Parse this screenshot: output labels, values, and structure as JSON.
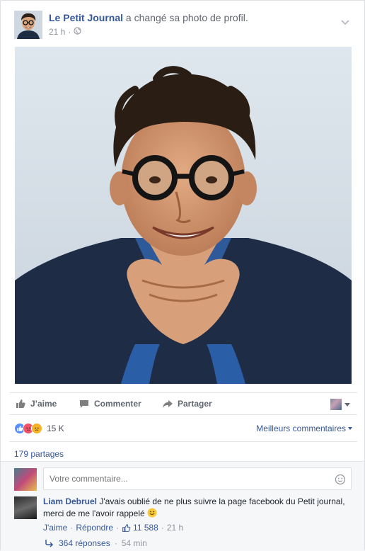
{
  "post": {
    "page_name": "Le Petit Journal",
    "action_text": "a changé sa photo de profil.",
    "time": "21 h",
    "separator": "·"
  },
  "actions": {
    "like": "J’aime",
    "comment": "Commenter",
    "share": "Partager"
  },
  "reactions": {
    "count": "15 K",
    "sort_label": "Meilleurs commentaires",
    "icons": [
      "like-reaction-icon",
      "angry-reaction-icon",
      "sad-reaction-icon"
    ]
  },
  "shares": "179 partages",
  "comment_box": {
    "placeholder": "Votre commentaire..."
  },
  "comment": {
    "author": "Liam Debruel",
    "text": "J'avais oublié de ne plus suivre la page facebook du Petit journal, merci de me l'avoir rappelé",
    "like_label": "J'aime",
    "reply_label": "Répondre",
    "likes": "11 588",
    "time": "21 h",
    "replies": "364 réponses",
    "replies_time": "54 min"
  },
  "colors": {
    "link": "#365899",
    "meta": "#90949c",
    "like_blue": "#5890ff",
    "angry": "#f25268",
    "sad": "#f7b125"
  }
}
